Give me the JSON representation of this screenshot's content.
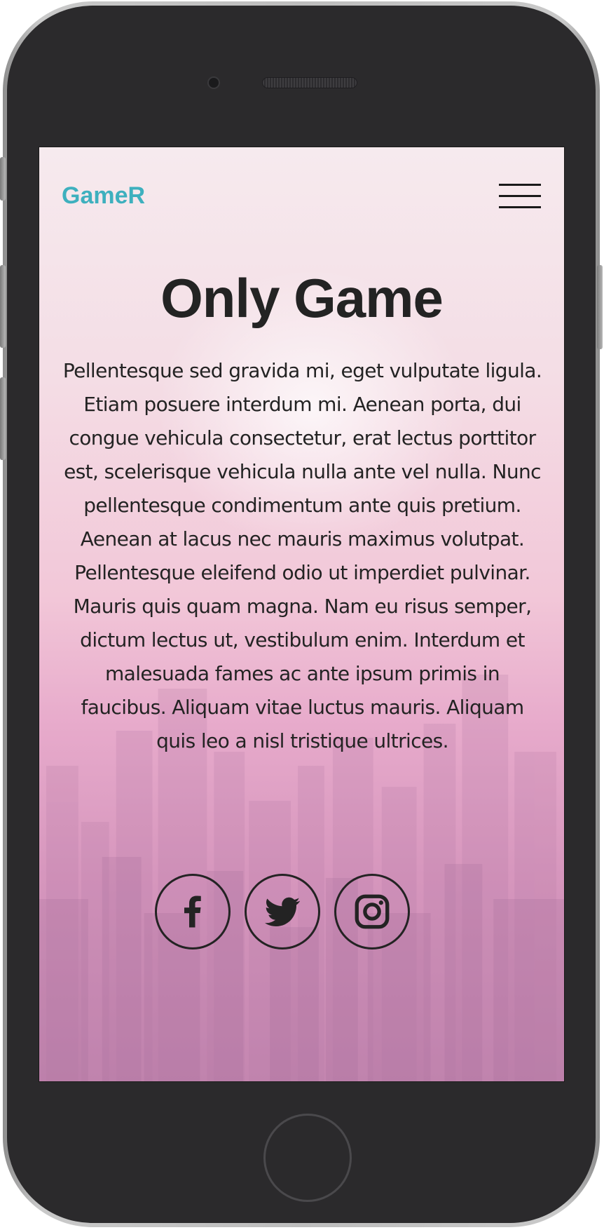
{
  "app": {
    "logo": "GameR",
    "menu_icon": "hamburger-menu-icon"
  },
  "hero": {
    "title": "Only Game",
    "body": "Pellentesque sed gravida mi, eget vulputate ligula. Etiam posuere interdum mi. Aenean porta, dui congue vehicula consectetur, erat lectus porttitor est, scelerisque vehicula nulla ante vel nulla. Nunc pellentesque condimentum ante quis pretium. Aenean at lacus nec mauris maximus volutpat. Pellentesque eleifend odio ut imperdiet pulvinar. Mauris quis quam magna. Nam eu risus semper, dictum lectus ut, vestibulum enim. Interdum et malesuada fames ac ante ipsum primis in faucibus. Aliquam vitae luctus mauris. Aliquam quis leo a nisl tristique ultrices."
  },
  "social": [
    {
      "icon": "facebook-icon"
    },
    {
      "icon": "twitter-icon"
    },
    {
      "icon": "instagram-icon"
    }
  ],
  "colors": {
    "logo": "#3eb0be",
    "text": "#232323",
    "device_body": "#2b2a2c"
  }
}
